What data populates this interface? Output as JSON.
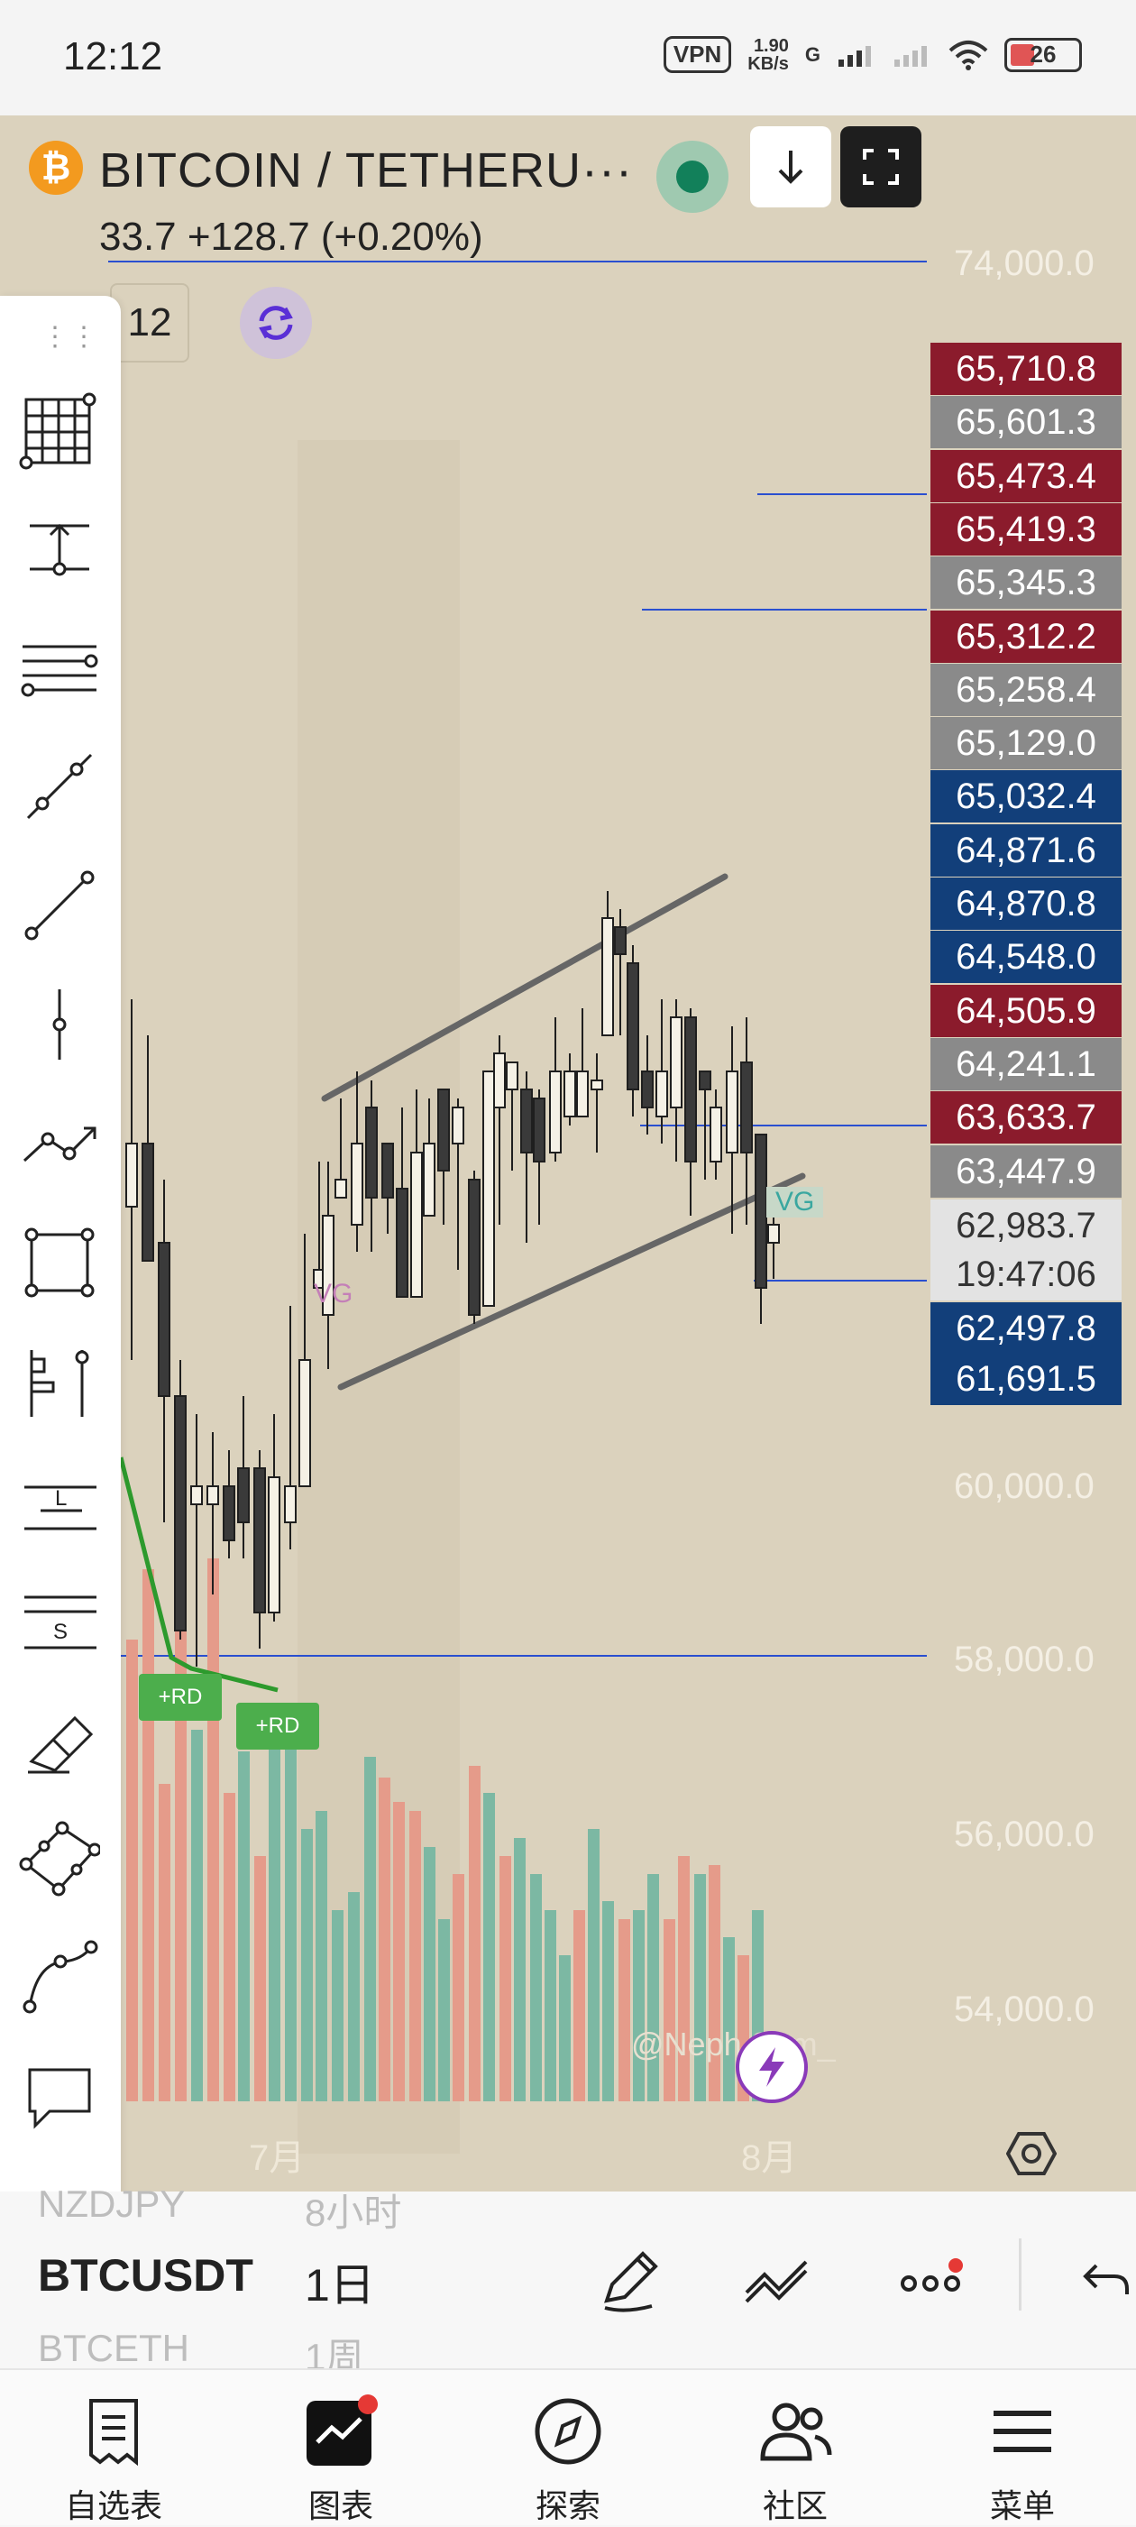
{
  "status_bar": {
    "time": "12:12",
    "vpn": "VPN",
    "speed_value": "1.90",
    "speed_unit": "KB/s",
    "network": "G",
    "battery": "26"
  },
  "header": {
    "logo_letter": "₿",
    "title": "BITCOIN / TETHERU···",
    "price_change": "33.7  +128.7 (+0.20%)",
    "interval": "12"
  },
  "price_axis": {
    "ticks": [
      "74,000.0",
      "60,000.0",
      "58,000.0",
      "56,000.0",
      "54,000.0"
    ]
  },
  "price_labels": [
    {
      "value": "65,710.8",
      "color": "red"
    },
    {
      "value": "65,601.3",
      "color": "grey"
    },
    {
      "value": "65,473.4",
      "color": "red"
    },
    {
      "value": "65,419.3",
      "color": "red"
    },
    {
      "value": "65,345.3",
      "color": "grey"
    },
    {
      "value": "65,312.2",
      "color": "red"
    },
    {
      "value": "65,258.4",
      "color": "grey"
    },
    {
      "value": "65,129.0",
      "color": "grey"
    },
    {
      "value": "65,032.4",
      "color": "blue"
    },
    {
      "value": "64,871.6",
      "color": "blue"
    },
    {
      "value": "64,870.8",
      "color": "blue"
    },
    {
      "value": "64,548.0",
      "color": "blue"
    },
    {
      "value": "64,505.9",
      "color": "red"
    },
    {
      "value": "64,241.1",
      "color": "grey"
    },
    {
      "value": "63,633.7",
      "color": "red"
    },
    {
      "value": "63,447.9",
      "color": "grey"
    }
  ],
  "current_price": {
    "price": "62,983.7",
    "countdown": "19:47:06"
  },
  "price_labels_below": [
    {
      "value": "62,497.8",
      "color": "blue"
    },
    {
      "value": "61,691.5",
      "color": "blue"
    }
  ],
  "time_axis": {
    "months": [
      "7月",
      "8月"
    ]
  },
  "markers": {
    "rd1": "+RD",
    "rd2": "+RD",
    "vg1": "VG",
    "vg2": "VG"
  },
  "watermark": "@Neph    Sam_",
  "toolbar": {
    "tools": [
      "grid-tool",
      "horizontal-ray-tool",
      "parallel-lines-tool",
      "trend-segment-tool",
      "trend-line-tool",
      "vertical-line-tool",
      "path-tool",
      "rectangle-tool",
      "long-position-tool",
      "long-label-tool",
      "short-label-tool",
      "brush-tool",
      "polygon-tool",
      "curve-tool",
      "comment-tool",
      "more-tool"
    ],
    "long_letter": "L",
    "short_letter": "S"
  },
  "symbol_bar": {
    "prev_symbol": "NZDJPY",
    "prev_interval": "8小时",
    "symbol": "BTCUSDT",
    "interval": "1日",
    "next_symbol": "BTCETH",
    "next_interval": "1周"
  },
  "bottom_nav": {
    "items": [
      "自选表",
      "图表",
      "探索",
      "社区",
      "菜单"
    ]
  },
  "colors": {
    "chart_bg": "#dbd2bd",
    "tag_red": "#8b1b2c",
    "tag_grey": "#8a8a8a",
    "tag_blue": "#123f7a",
    "volume_up": "#7cb8a3",
    "volume_down": "#e59b8a",
    "level_line": "#2a4fd0",
    "channel_line": "#666666",
    "trend_green": "#2d9a2d"
  }
}
